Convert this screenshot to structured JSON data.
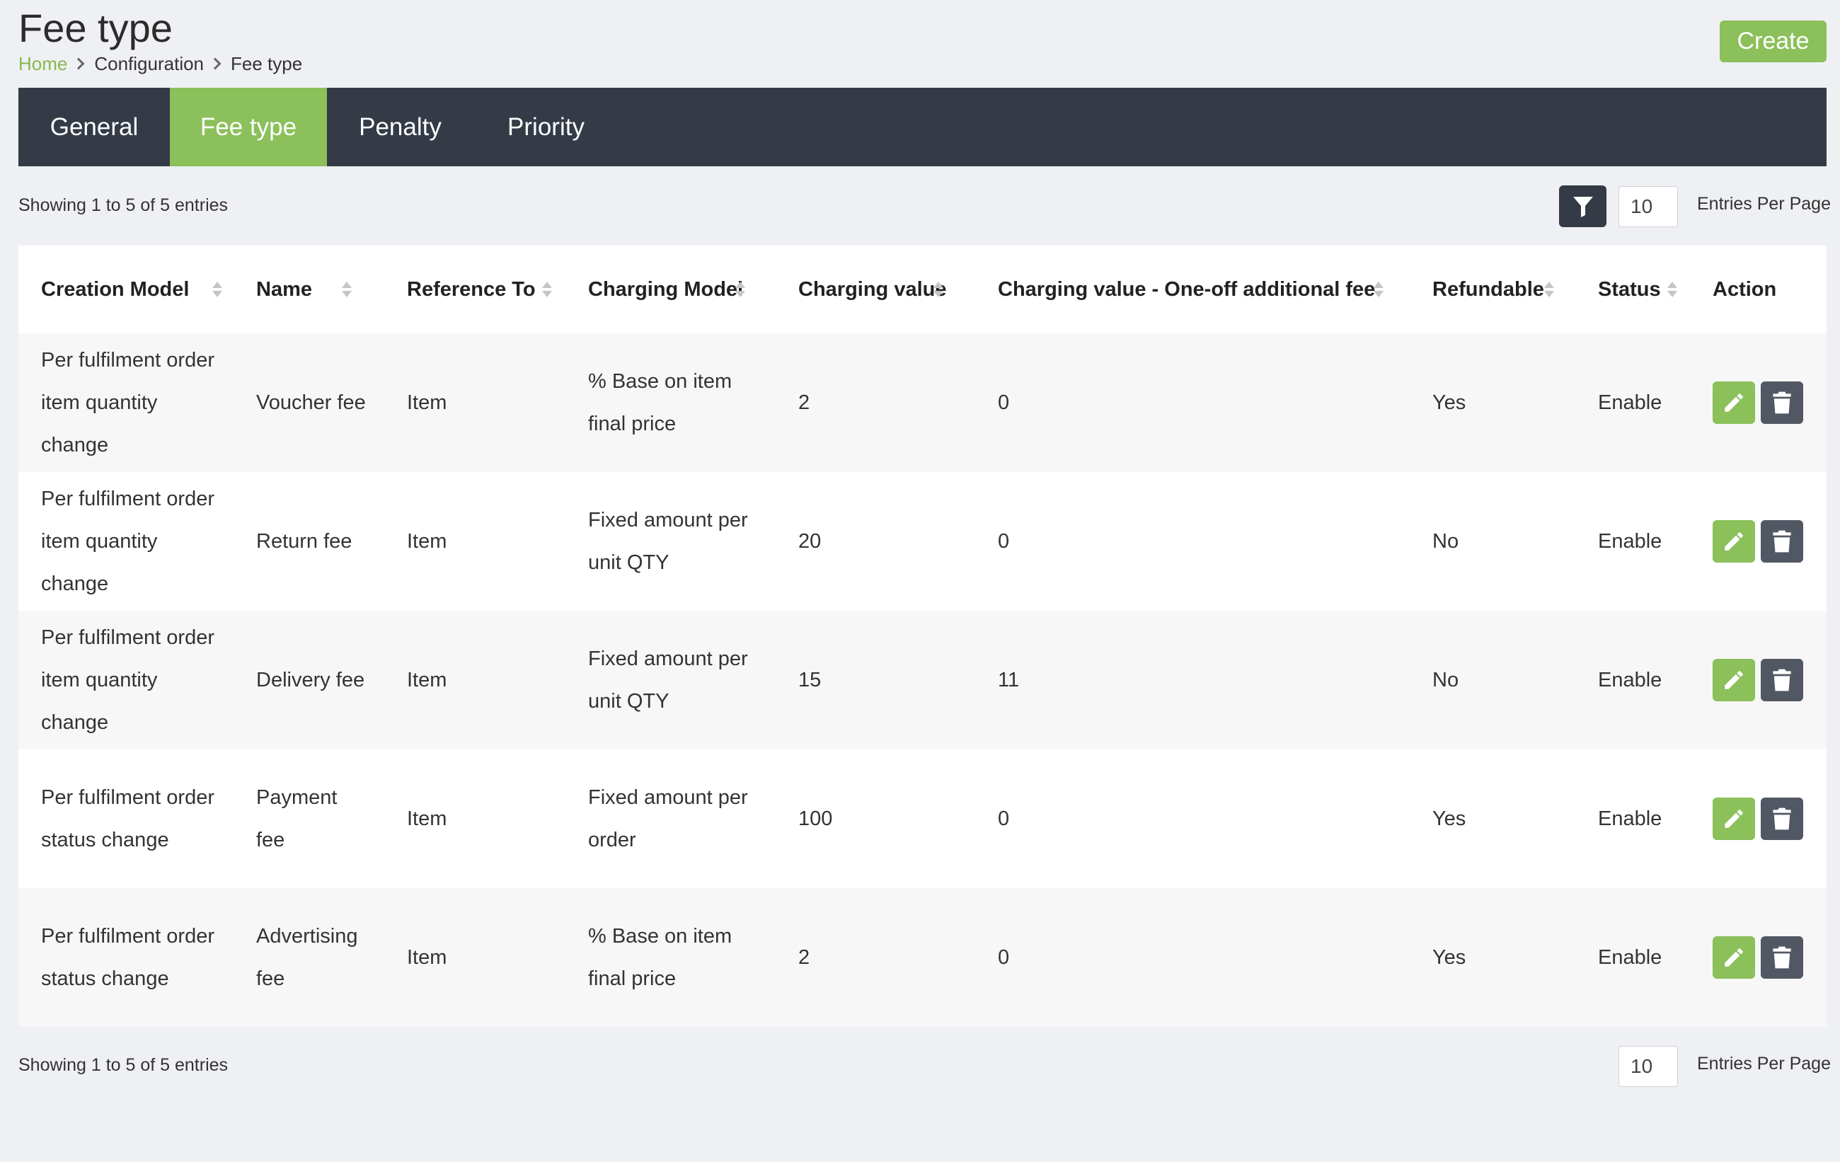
{
  "page": {
    "title": "Fee type",
    "create_label": "Create"
  },
  "breadcrumb": {
    "items": [
      "Home",
      "Configuration",
      "Fee type"
    ]
  },
  "tabs": [
    {
      "label": "General",
      "active": false
    },
    {
      "label": "Fee type",
      "active": true
    },
    {
      "label": "Penalty",
      "active": false
    },
    {
      "label": "Priority",
      "active": false
    }
  ],
  "listing": {
    "showing_text": "Showing 1 to 5 of 5 entries",
    "per_page_value": "10",
    "per_page_label": "Entries Per Page"
  },
  "table": {
    "columns": [
      "Creation Model",
      "Name",
      "Reference To",
      "Charging Model",
      "Charging value",
      "Charging value - One-off additional fee",
      "Refundable",
      "Status",
      "Action"
    ],
    "rows": [
      {
        "creation_model": "Per fulfilment order item quantity change",
        "name": "Voucher fee",
        "reference_to": "Item",
        "charging_model": "% Base on item final price",
        "charging_value": "2",
        "one_off_fee": "0",
        "refundable": "Yes",
        "status": "Enable"
      },
      {
        "creation_model": "Per fulfilment order item quantity change",
        "name": "Return fee",
        "reference_to": "Item",
        "charging_model": "Fixed amount per unit QTY",
        "charging_value": "20",
        "one_off_fee": "0",
        "refundable": "No",
        "status": "Enable"
      },
      {
        "creation_model": "Per fulfilment order item quantity change",
        "name": "Delivery fee",
        "reference_to": "Item",
        "charging_model": "Fixed amount per unit QTY",
        "charging_value": "15",
        "one_off_fee": "11",
        "refundable": "No",
        "status": "Enable"
      },
      {
        "creation_model": "Per fulfilment order status change",
        "name": "Payment fee",
        "reference_to": "Item",
        "charging_model": "Fixed amount per order",
        "charging_value": "100",
        "one_off_fee": "0",
        "refundable": "Yes",
        "status": "Enable"
      },
      {
        "creation_model": "Per fulfilment order status change",
        "name": "Advertising fee",
        "reference_to": "Item",
        "charging_model": "% Base on item final price",
        "charging_value": "2",
        "one_off_fee": "0",
        "refundable": "Yes",
        "status": "Enable"
      }
    ]
  },
  "icons": {
    "filter": "filter-icon",
    "edit": "pencil-icon",
    "delete": "trash-icon",
    "breadcrumb_separator": "chevron-right-icon",
    "sort": "sort-icon"
  },
  "colors": {
    "accent": "#8bc05a",
    "dark": "#343b46",
    "background": "#eff0f3",
    "link": "#86b94f"
  }
}
